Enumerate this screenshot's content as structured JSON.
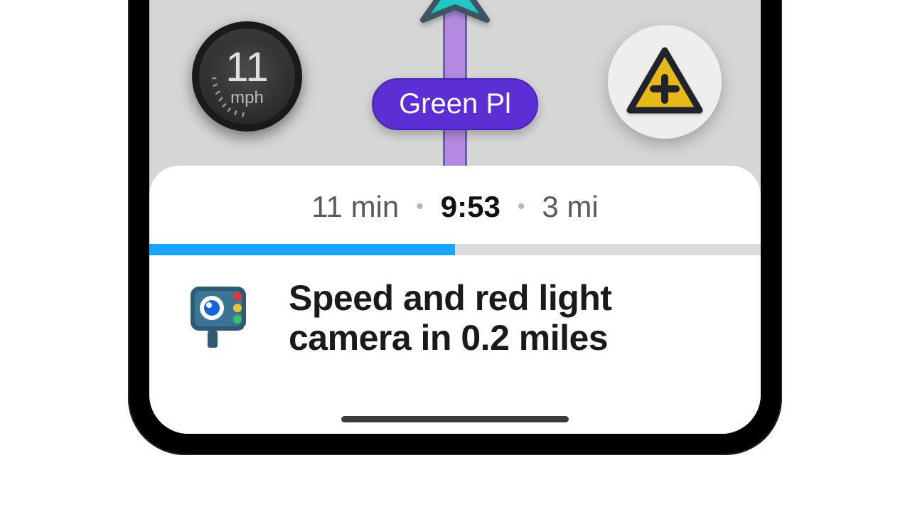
{
  "speedometer": {
    "value": "11",
    "unit": "mph"
  },
  "street": {
    "name": "Green Pl"
  },
  "trip": {
    "remaining_time": "11 min",
    "eta": "9:53",
    "distance": "3 mi",
    "progress_percent": 50
  },
  "alert": {
    "message": "Speed and red light camera in 0.2 miles"
  },
  "colors": {
    "route": "#b28be0",
    "street_pill": "#5b2fd4",
    "progress_fill": "#1aa3ff",
    "report_triangle": "#e6b819",
    "vehicle_arrow": "#21c7c7"
  }
}
